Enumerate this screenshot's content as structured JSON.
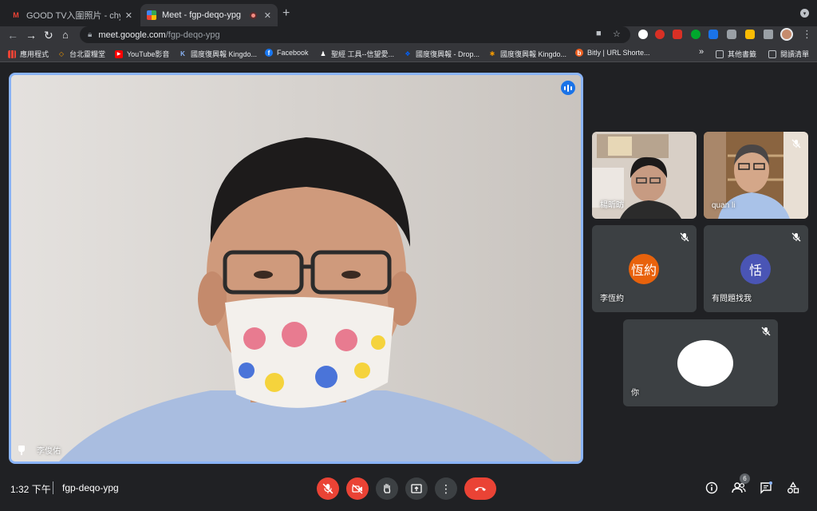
{
  "browser": {
    "tabs": [
      {
        "title": "GOOD TV入圍照片 - chyyuan.w"
      },
      {
        "title": "Meet - fgp-deqo-ypg"
      }
    ],
    "url": {
      "host": "meet.google.com",
      "path": "/fgp-deqo-ypg"
    },
    "bookmarks": [
      {
        "label": "應用程式"
      },
      {
        "label": "台北靈糧堂"
      },
      {
        "label": "YouTube影音"
      },
      {
        "label": "國度復興報 Kingdo..."
      },
      {
        "label": "Facebook"
      },
      {
        "label": "聖經 工具--信望愛..."
      },
      {
        "label": "國度復興報 - Drop..."
      },
      {
        "label": "國度復興報 Kingdo..."
      },
      {
        "label": "Bitly | URL Shorte..."
      }
    ],
    "overflow": "»",
    "other_bookmarks": "其他書籤",
    "reading_list": "閱讀清單"
  },
  "meet": {
    "main": {
      "name": "李俊佑"
    },
    "participants": [
      {
        "name": "楊昕昉",
        "type": "video",
        "muted": false
      },
      {
        "name": "quan li",
        "type": "video",
        "muted": true
      },
      {
        "name": "李恆約",
        "initials": "恆約",
        "color": "#e8620c",
        "type": "avatar",
        "muted": true
      },
      {
        "name": "有問題找我",
        "initials": "恬",
        "color": "#4a55b5",
        "type": "avatar",
        "muted": true
      },
      {
        "name": "你",
        "type": "self",
        "muted": true
      }
    ],
    "time": "1:32 下午",
    "meeting_code": "fgp-deqo-ypg",
    "people_count": "6"
  },
  "colors": {
    "accent": "#8ab4f8",
    "danger": "#ea4335",
    "tile": "#3c4043",
    "bg": "#202124"
  }
}
